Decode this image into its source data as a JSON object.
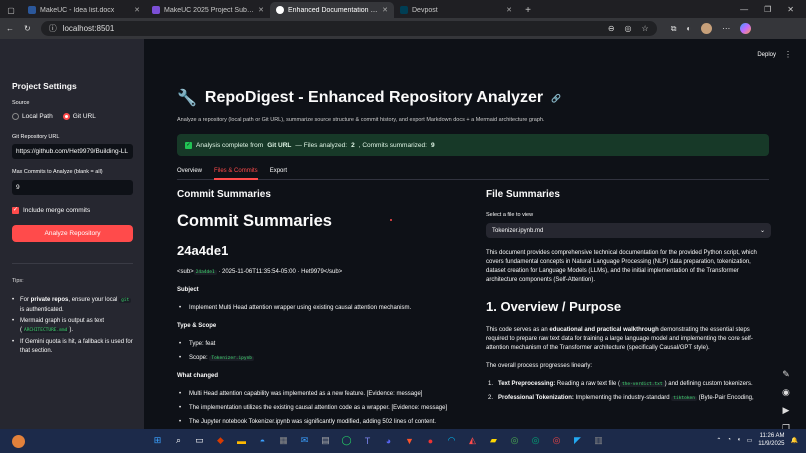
{
  "browser": {
    "tabs": [
      {
        "label": "MakeUC - Idea list.docx",
        "icon_color": "#2b579a",
        "active": false
      },
      {
        "label": "MakeUC 2025 Project Submission",
        "icon_color": "#7b4fd6",
        "active": false
      },
      {
        "label": "Enhanced Documentation Genera",
        "icon_color": "#ffffff",
        "active": true
      },
      {
        "label": "Devpost",
        "icon_color": "#003e54",
        "active": false
      }
    ],
    "new_tab": "+",
    "url": "localhost:8501"
  },
  "app_header": {
    "deploy": "Deploy",
    "menu": "⋮"
  },
  "sidebar": {
    "title": "Project Settings",
    "source_label": "Source",
    "radio_local": "Local Path",
    "radio_git": "Git URL",
    "git_url_label": "Git Repository URL",
    "git_url_value": "https://github.com/Het9979/Building-LL",
    "max_commits_label": "Max Commits to Analyze (blank = all)",
    "max_commits_value": "9",
    "include_merge_label": "Include merge commits",
    "analyze_button": "Analyze Repository",
    "tips_label": "Tips:",
    "tip1_a": "For ",
    "tip1_b": "private repos",
    "tip1_c": ", ensure your local ",
    "tip1_code": "git",
    "tip1_d": " is authenticated.",
    "tip2_a": "Mermaid graph is output as text (",
    "tip2_code": "ARCHITECTURE.mmd",
    "tip2_b": ").",
    "tip3": "If Gemini quota is hit, a fallback is used for that section."
  },
  "main": {
    "title": "RepoDigest - Enhanced Repository Analyzer",
    "title_icon": "🔧",
    "subtitle": "Analyze a repository (local path or Git URL), summarize source structure & commit history, and export Markdown docs + a Mermaid architecture graph.",
    "success_a": "Analysis complete from ",
    "success_b": "Git URL",
    "success_c": " — Files analyzed: ",
    "success_files": "2",
    "success_d": ", Commits summarized: ",
    "success_commits": "9",
    "tabs": [
      "Overview",
      "Files & Commits",
      "Export"
    ]
  },
  "commits": {
    "heading": "Commit Summaries",
    "big_heading": "Commit Summaries",
    "hash": "24a4de1",
    "meta_a": "<sub>",
    "meta_code": "24a4de1",
    "meta_b": " · 2025-11-06T11:35:54-05:00 · Het9979</sub>",
    "subject_label": "Subject",
    "subject_item": "Implement Multi Head attention wrapper using existing causal attention mechanism.",
    "type_label": "Type & Scope",
    "type_item": "Type: feat",
    "scope_label": "Scope: ",
    "scope_code": "Tokenizer.ipynb",
    "changed_label": "What changed",
    "changed_1": "Multi Head attention capability was implemented as a new feature. [Evidence: message]",
    "changed_2": "The implementation utilizes the existing causal attention code as a wrapper. [Evidence: message]",
    "changed_3": "The Jupyter notebook Tokenizer.ipynb was significantly modified, adding 502 lines of content."
  },
  "files": {
    "heading": "File Summaries",
    "select_label": "Select a file to view",
    "select_value": "Tokenizer.ipynb.md",
    "intro": "This document provides comprehensive technical documentation for the provided Python script, which covers fundamental concepts in Natural Language Processing (NLP) data preparation, tokenization, dataset creation for Language Models (LLMs), and the initial implementation of the Transformer architecture components (Self-Attention).",
    "overview_heading": "1. Overview / Purpose",
    "overview_a": "This code serves as an ",
    "overview_b": "educational and practical walkthrough",
    "overview_c": " demonstrating the essential steps required to prepare raw text data for training a large language model and implementing the core self-attention mechanism of the Transformer architecture (specifically Causal/GPT style).",
    "process_text": "The overall process progresses linearly:",
    "step1_b": "Text Preprocessing:",
    "step1_a": " Reading a raw text file (",
    "step1_code": "the-verdict.txt",
    "step1_c": ") and defining custom tokenizers.",
    "step2_b": "Professional Tokenization:",
    "step2_a": " Implementing the industry-standard ",
    "step2_code": "tiktoken",
    "step2_c": " (Byte-Pair Encoding,"
  },
  "taskbar": {
    "time": "11:26 AM",
    "date": "11/9/2025"
  }
}
